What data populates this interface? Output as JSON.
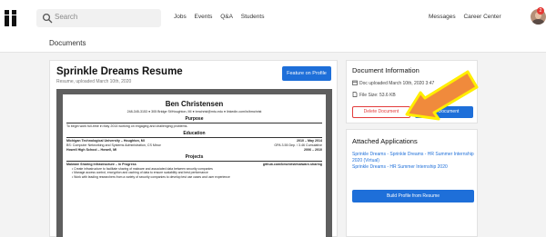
{
  "nav": {
    "search_placeholder": "Search",
    "links": [
      "Jobs",
      "Events",
      "Q&A",
      "Students"
    ],
    "right_links": [
      "Messages",
      "Career Center"
    ],
    "notification_count": "2"
  },
  "page": {
    "title": "Documents"
  },
  "resume": {
    "title": "Sprinkle Dreams Resume",
    "subtitle": "Resume, uploaded March 10th, 2020",
    "feature_button": "Feature on Profile"
  },
  "doc_preview": {
    "name": "Ben Christensen",
    "contact": "248-345-3153 ● 305 Bridge St/Houghton, MI ● bmchrist@mtu.edu ● linkedin.com/in/bmchrist",
    "purpose_heading": "Purpose",
    "purpose_text": "To begin work full-time in May 2014 working on engaging and challenging problems.",
    "education_heading": "Education",
    "edu_school": "Michigan Technological University – Houghton, MI",
    "edu_school_date": "2010 – May 2014",
    "edu_degree": "BS: Computer Networking and Systems Administration, CS Minor",
    "edu_gpa": "GPA 3.55 Dep. / 3.46 Cumulative",
    "edu_hs": "Howell High School – Howell, MI",
    "edu_hs_date": "2006 – 2010",
    "projects_heading": "Projects",
    "proj_title": "Malware Sharing Infrastructure – In Progress",
    "proj_link": "github.com/bmchrist/malware-sharing",
    "proj_bullets": [
      "Create infrastructure to facilitate sharing of malware and associated data between security companies",
      "Manage access control, encryption and caching of data to ensure scalability and best performance",
      "Work with leading researchers from a variety of security companies to develop test use cases and user experience"
    ]
  },
  "info": {
    "title": "Document Information",
    "uploaded": "Doc uploaded March 10th, 2020 3:47",
    "size": "File Size: 53.6 KB",
    "delete_button": "Delete Document",
    "edit_button": "Edit Document"
  },
  "apps": {
    "title": "Attached Applications",
    "items": [
      "Sprinkle Dreams - Sprinkle Dreams - HR Summer Internship 2020 (Virtual)",
      "Sprinkle Dreams - HR Summer Internship 2020"
    ],
    "build_button": "Build Profile from Resume"
  },
  "colors": {
    "accent_blue": "#1e6fd9",
    "danger_red": "#e23b3b",
    "arrow_orange": "#f08a3c",
    "arrow_outline": "#ffee00"
  }
}
